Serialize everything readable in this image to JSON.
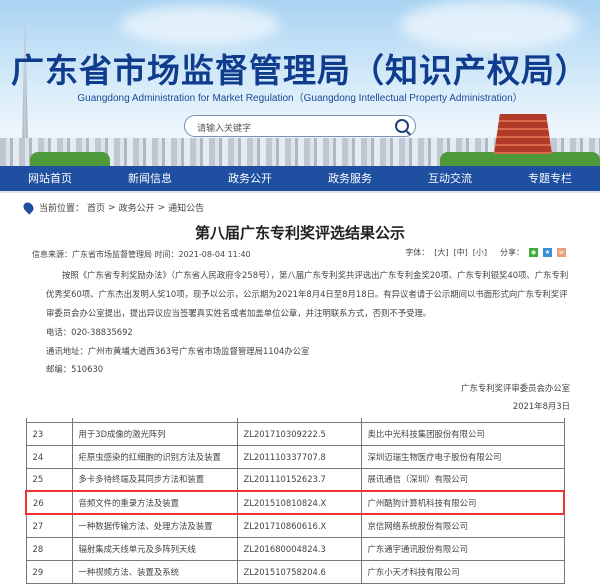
{
  "header": {
    "title": "广东省市场监督管理局（知识产权局）",
    "subtitle": "Guangdong Administration for Market Regulation（Guangdong Intellectual Property Administration）",
    "search_placeholder": "请输入关键字"
  },
  "nav": [
    "网站首页",
    "新闻信息",
    "政务公开",
    "政务服务",
    "互动交流",
    "专题专栏"
  ],
  "breadcrumb": {
    "label": "当前位置：",
    "items": [
      "首页",
      "政务公开",
      "通知公告"
    ],
    "sep": ">"
  },
  "article": {
    "title": "第八届广东专利奖评选结果公示",
    "meta": "信息来源：广东省市场监督管理局  时间：2021-08-04 11:40",
    "font_label": "字体：",
    "font_sizes": [
      "[大]",
      "[中]",
      "[小]"
    ],
    "share_label": "分享：",
    "share_icons": [
      "wechat-icon",
      "qzone-icon",
      "weibo-icon"
    ],
    "body": "按照《广东省专利奖励办法》（广东省人民政府令258号），第八届广东专利奖共评选出广东专利金奖20项、广东专利银奖40项、广东专利优秀奖60项、广东杰出发明人奖10项，现予以公示，公示期为2021年8月4日至8月18日。有异议者请于公示期间以书面形式向广东专利奖评审委员会办公室提出，提出异议应当签署真实姓名或者加盖单位公章，并注明联系方式，否则不予受理。",
    "phone": "电话：020-38835692",
    "address": "通讯地址：广州市黄埔大道西363号广东省市场监督管理局1104办公室",
    "zip": "邮编：510630",
    "signer": "广东专利奖评审委员会办公室",
    "date": "2021年8月3日"
  },
  "table": {
    "highlight_color": "#e33333",
    "rows": [
      [
        "23",
        "用于3D成像的激光阵列",
        "ZL201710309222.5",
        "奥比中光科技集团股份有限公司"
      ],
      [
        "24",
        "疟原虫感染的红细胞的识别方法及装置",
        "ZL201110337707.8",
        "深圳迈瑞生物医疗电子股份有限公司"
      ],
      [
        "25",
        "多卡多待终端及其同步方法和装置",
        "ZL201110152623.7",
        "展讯通信（深圳）有限公司"
      ],
      [
        "26",
        "音频文件的重录方法及装置",
        "ZL201510810824.X",
        "广州酷狗计算机科技有限公司"
      ],
      [
        "27",
        "一种数据传输方法、处理方法及装置",
        "ZL201710860616.X",
        "京信网络系统股份有限公司"
      ],
      [
        "28",
        "辐射集成天线单元及多阵列天线",
        "ZL201680004824.3",
        "广东通宇通讯股份有限公司"
      ],
      [
        "29",
        "一种视频方法、装置及系统",
        "ZL201510758204.6",
        "广东小天才科技有限公司"
      ]
    ],
    "highlighted_row": "26"
  }
}
